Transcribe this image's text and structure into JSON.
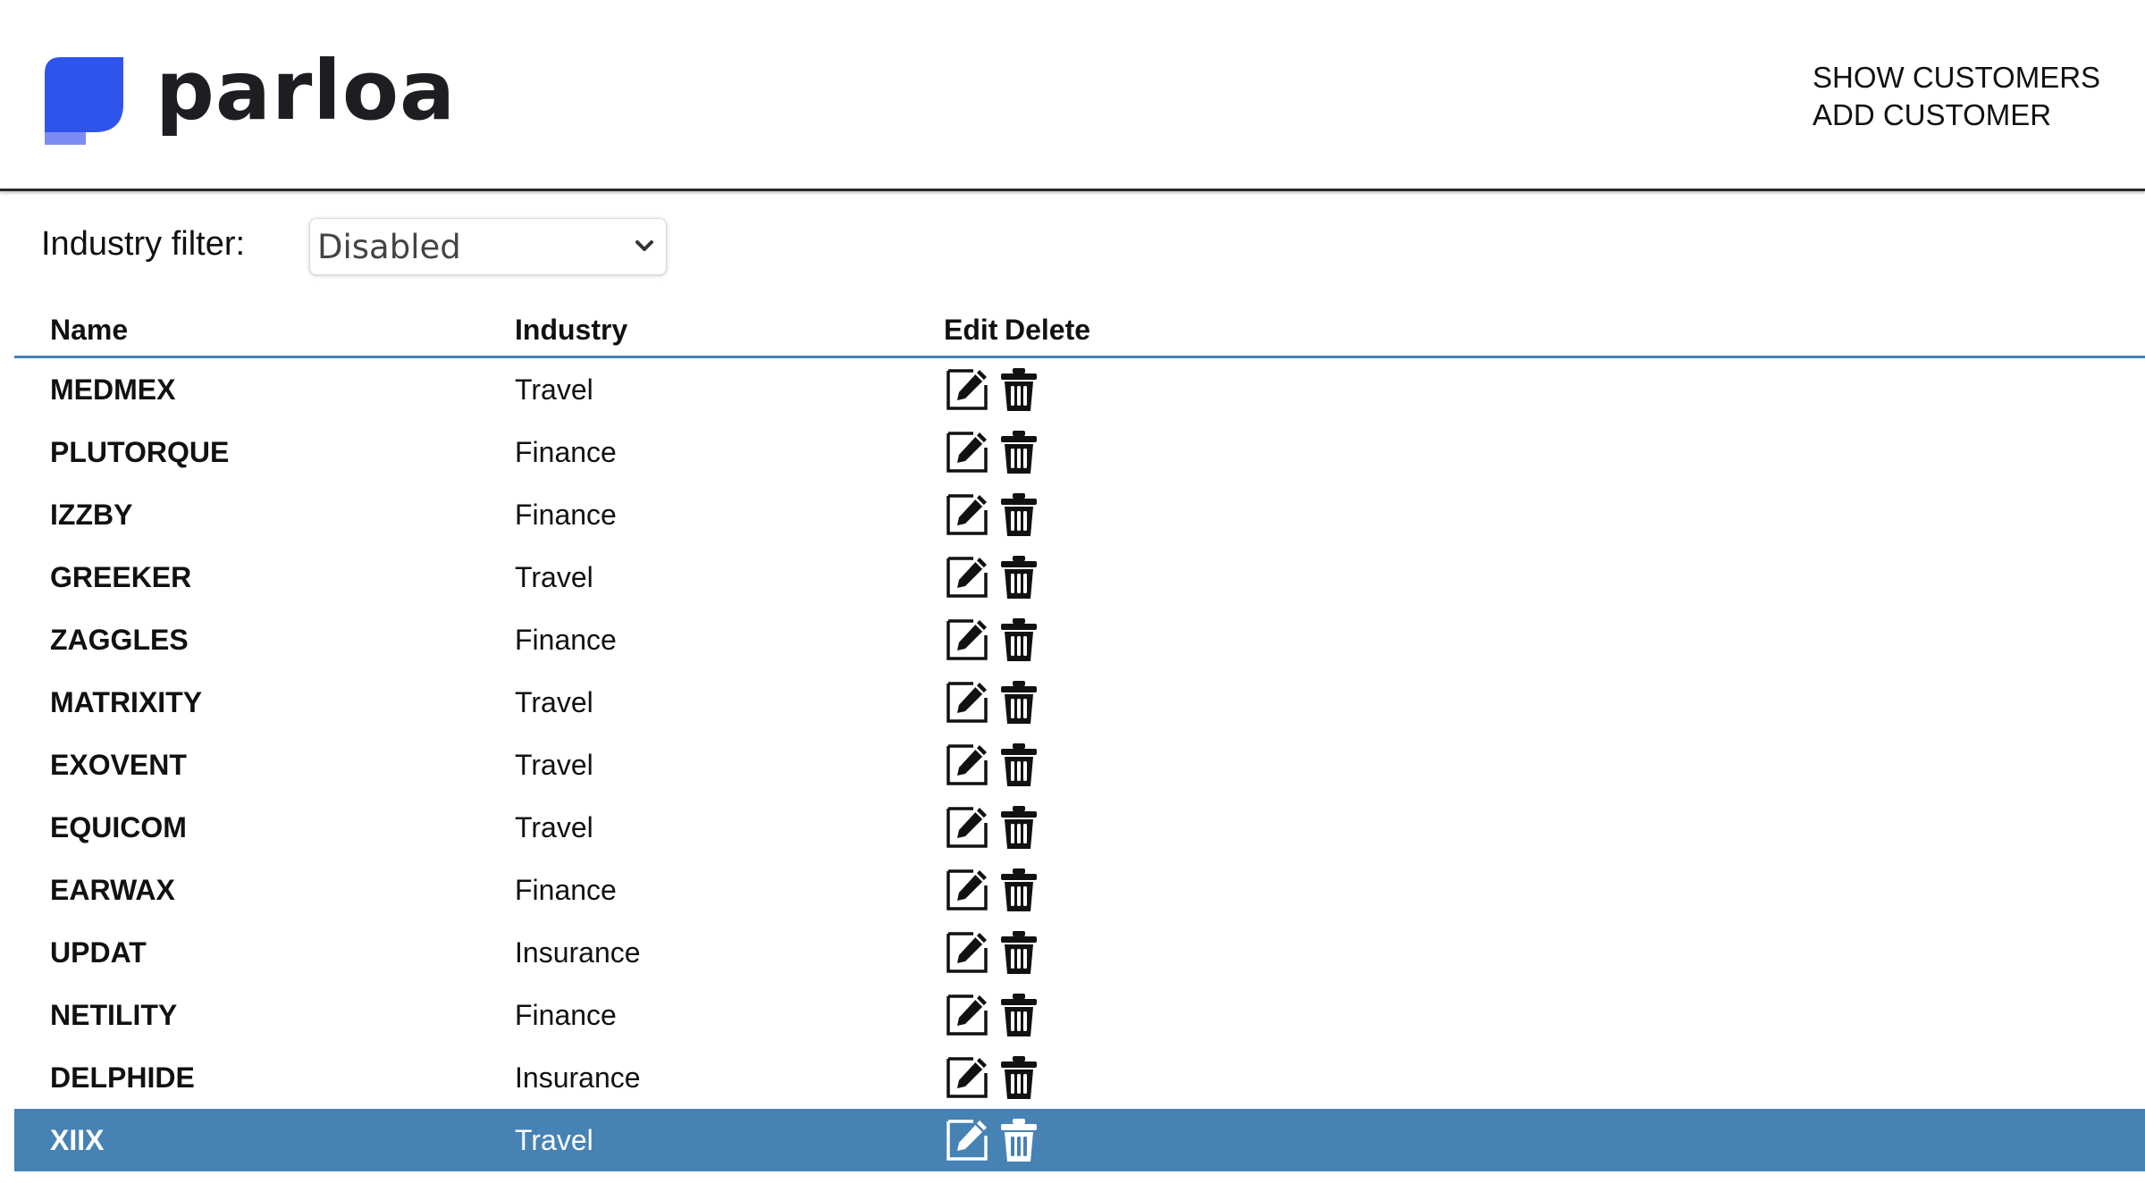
{
  "brand": {
    "name": "parloa",
    "accent_color": "#2f54eb",
    "accent_light": "#7b8cf5"
  },
  "nav": {
    "show_customers": "SHOW CUSTOMERS",
    "add_customer": "ADD CUSTOMER"
  },
  "filter": {
    "label": "Industry filter:",
    "selected": "Disabled"
  },
  "table": {
    "headers": {
      "name": "Name",
      "industry": "Industry",
      "edit": "Edit",
      "delete": "Delete"
    },
    "selected_row_color": "#4682b4",
    "rows": [
      {
        "name": "MEDMEX",
        "industry": "Travel"
      },
      {
        "name": "PLUTORQUE",
        "industry": "Finance"
      },
      {
        "name": "IZZBY",
        "industry": "Finance"
      },
      {
        "name": "GREEKER",
        "industry": "Travel"
      },
      {
        "name": "ZAGGLES",
        "industry": "Finance"
      },
      {
        "name": "MATRIXITY",
        "industry": "Travel"
      },
      {
        "name": "EXOVENT",
        "industry": "Travel"
      },
      {
        "name": "EQUICOM",
        "industry": "Travel"
      },
      {
        "name": "EARWAX",
        "industry": "Finance"
      },
      {
        "name": "UPDAT",
        "industry": "Insurance"
      },
      {
        "name": "NETILITY",
        "industry": "Finance"
      },
      {
        "name": "DELPHIDE",
        "industry": "Insurance"
      },
      {
        "name": "XIIX",
        "industry": "Travel",
        "selected": true
      }
    ],
    "row_icons": {
      "edit": "edit-icon",
      "delete": "trash-icon"
    }
  }
}
